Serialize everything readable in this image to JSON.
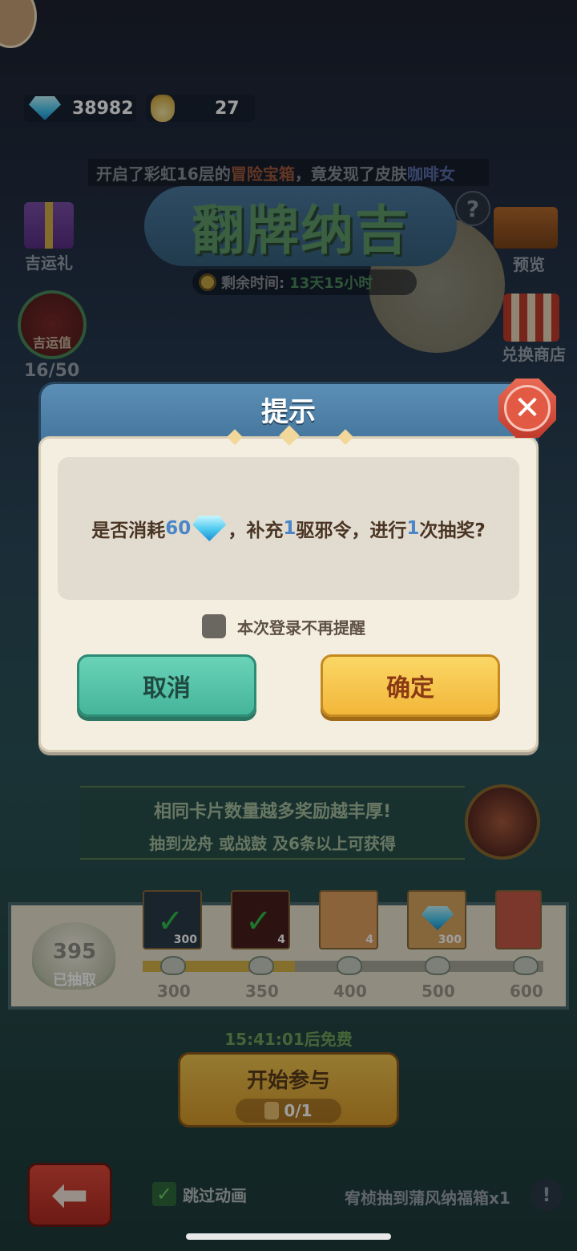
{
  "currency": {
    "gems": "38982",
    "bags": "27"
  },
  "marquee": {
    "prefix": "开启了彩虹16层的",
    "item": "冒险宝箱",
    "mid": "，竟发现了皮肤",
    "skin": "咖啡女"
  },
  "event": {
    "title": "翻牌纳吉",
    "help": "?",
    "timer_label": "剩余时间:",
    "timer_value": "13天15小时"
  },
  "side": {
    "lucky_gift": "吉运礼",
    "preview": "预览",
    "exchange_shop": "兑换商店",
    "luck_value_label": "吉运值",
    "luck_value": "16/50"
  },
  "banner": {
    "line1": "相同卡片数量越多奖励越丰厚!",
    "line2": "抽到龙舟 或战鼓 及6条以上可获得"
  },
  "progress": {
    "drawn_count": "395",
    "drawn_label": "已抽取",
    "fill_fraction": 0.38,
    "milestones": [
      "300",
      "350",
      "400",
      "500",
      "600"
    ],
    "rewards": [
      {
        "icon": "gem-icon",
        "count": "300",
        "claimed": true
      },
      {
        "icon": "token-icon",
        "count": "4",
        "claimed": true
      },
      {
        "icon": "charm-icon",
        "count": "4",
        "claimed": false
      },
      {
        "icon": "gem-icon",
        "count": "300",
        "claimed": false
      },
      {
        "icon": "bag-icon",
        "count": "",
        "claimed": false
      }
    ]
  },
  "free_time": "15:41:01后免费",
  "start": {
    "label": "开始参与",
    "cost": "0/1"
  },
  "bottom": {
    "skip_animation": "跳过动画",
    "ticker": "宥桢抽到蒲风纳福箱x1",
    "info": "!"
  },
  "dialog": {
    "title": "提示",
    "message": {
      "p1": "是否消耗",
      "gem_cost": "60",
      "p2": "，补充",
      "token_count": "1",
      "p3": "驱邪令，进行",
      "draw_count": "1",
      "p4": "次抽奖?"
    },
    "remember": "本次登录不再提醒",
    "cancel": "取消",
    "confirm": "确定",
    "close": "✕"
  },
  "colors": {
    "cancel": "#45b59a",
    "confirm": "#f2b73a",
    "header": "#3f6f96",
    "highlight_num": "#4a86c8"
  }
}
